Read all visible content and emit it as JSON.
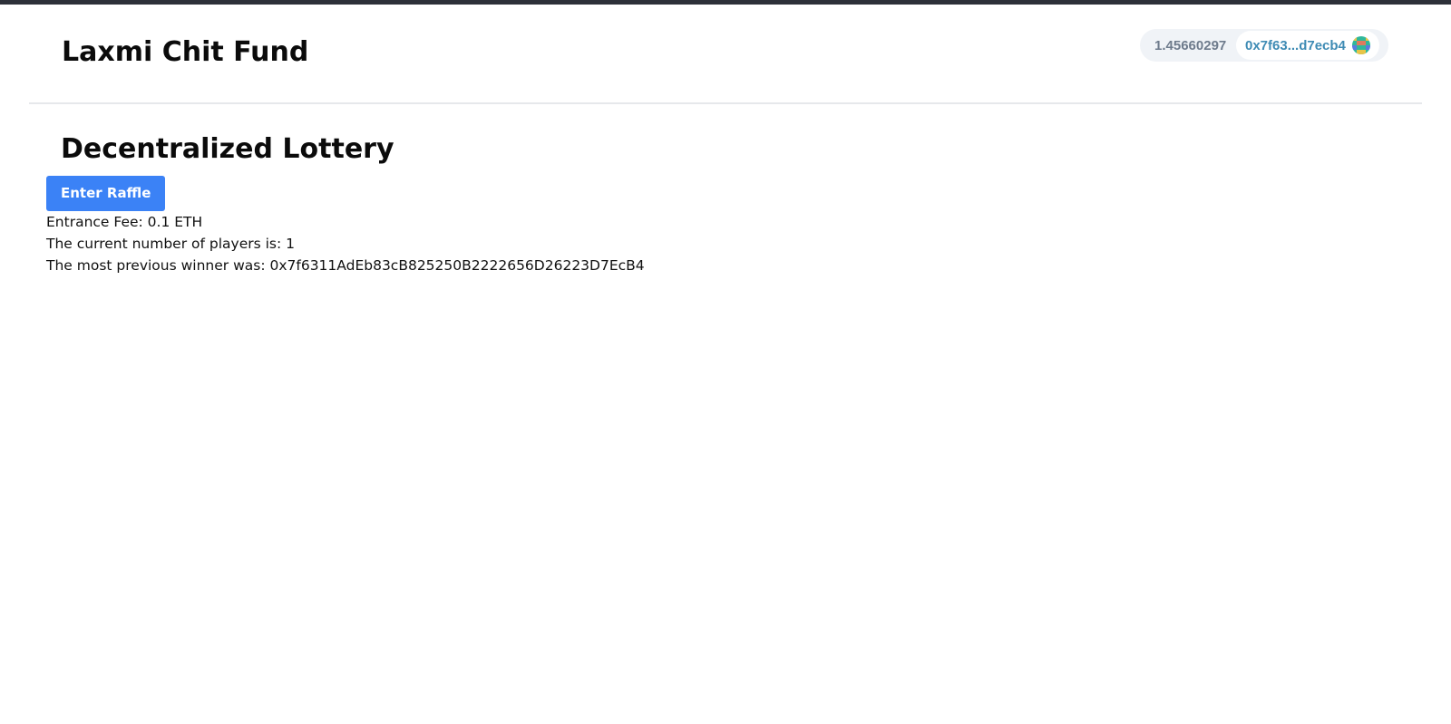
{
  "header": {
    "title": "Laxmi Chit Fund",
    "wallet": {
      "balance": "1.45660297",
      "account": "0x7f63...d7ecb4",
      "avatar_icon": "blockie-avatar-icon"
    }
  },
  "main": {
    "title": "Decentralized Lottery",
    "enter_button_label": "Enter Raffle",
    "entrance_fee": "Entrance Fee: 0.1 ETH",
    "players_count": "The current number of players is: 1",
    "previous_winner": "The most previous winner was: 0x7f6311AdEb83cB825250B2222656D26223D7EcB4"
  },
  "colors": {
    "accent": "#3b82f6",
    "top_bar": "#2d3039",
    "account_text": "#3e8bb4",
    "balance_text": "#6e7b8c"
  }
}
